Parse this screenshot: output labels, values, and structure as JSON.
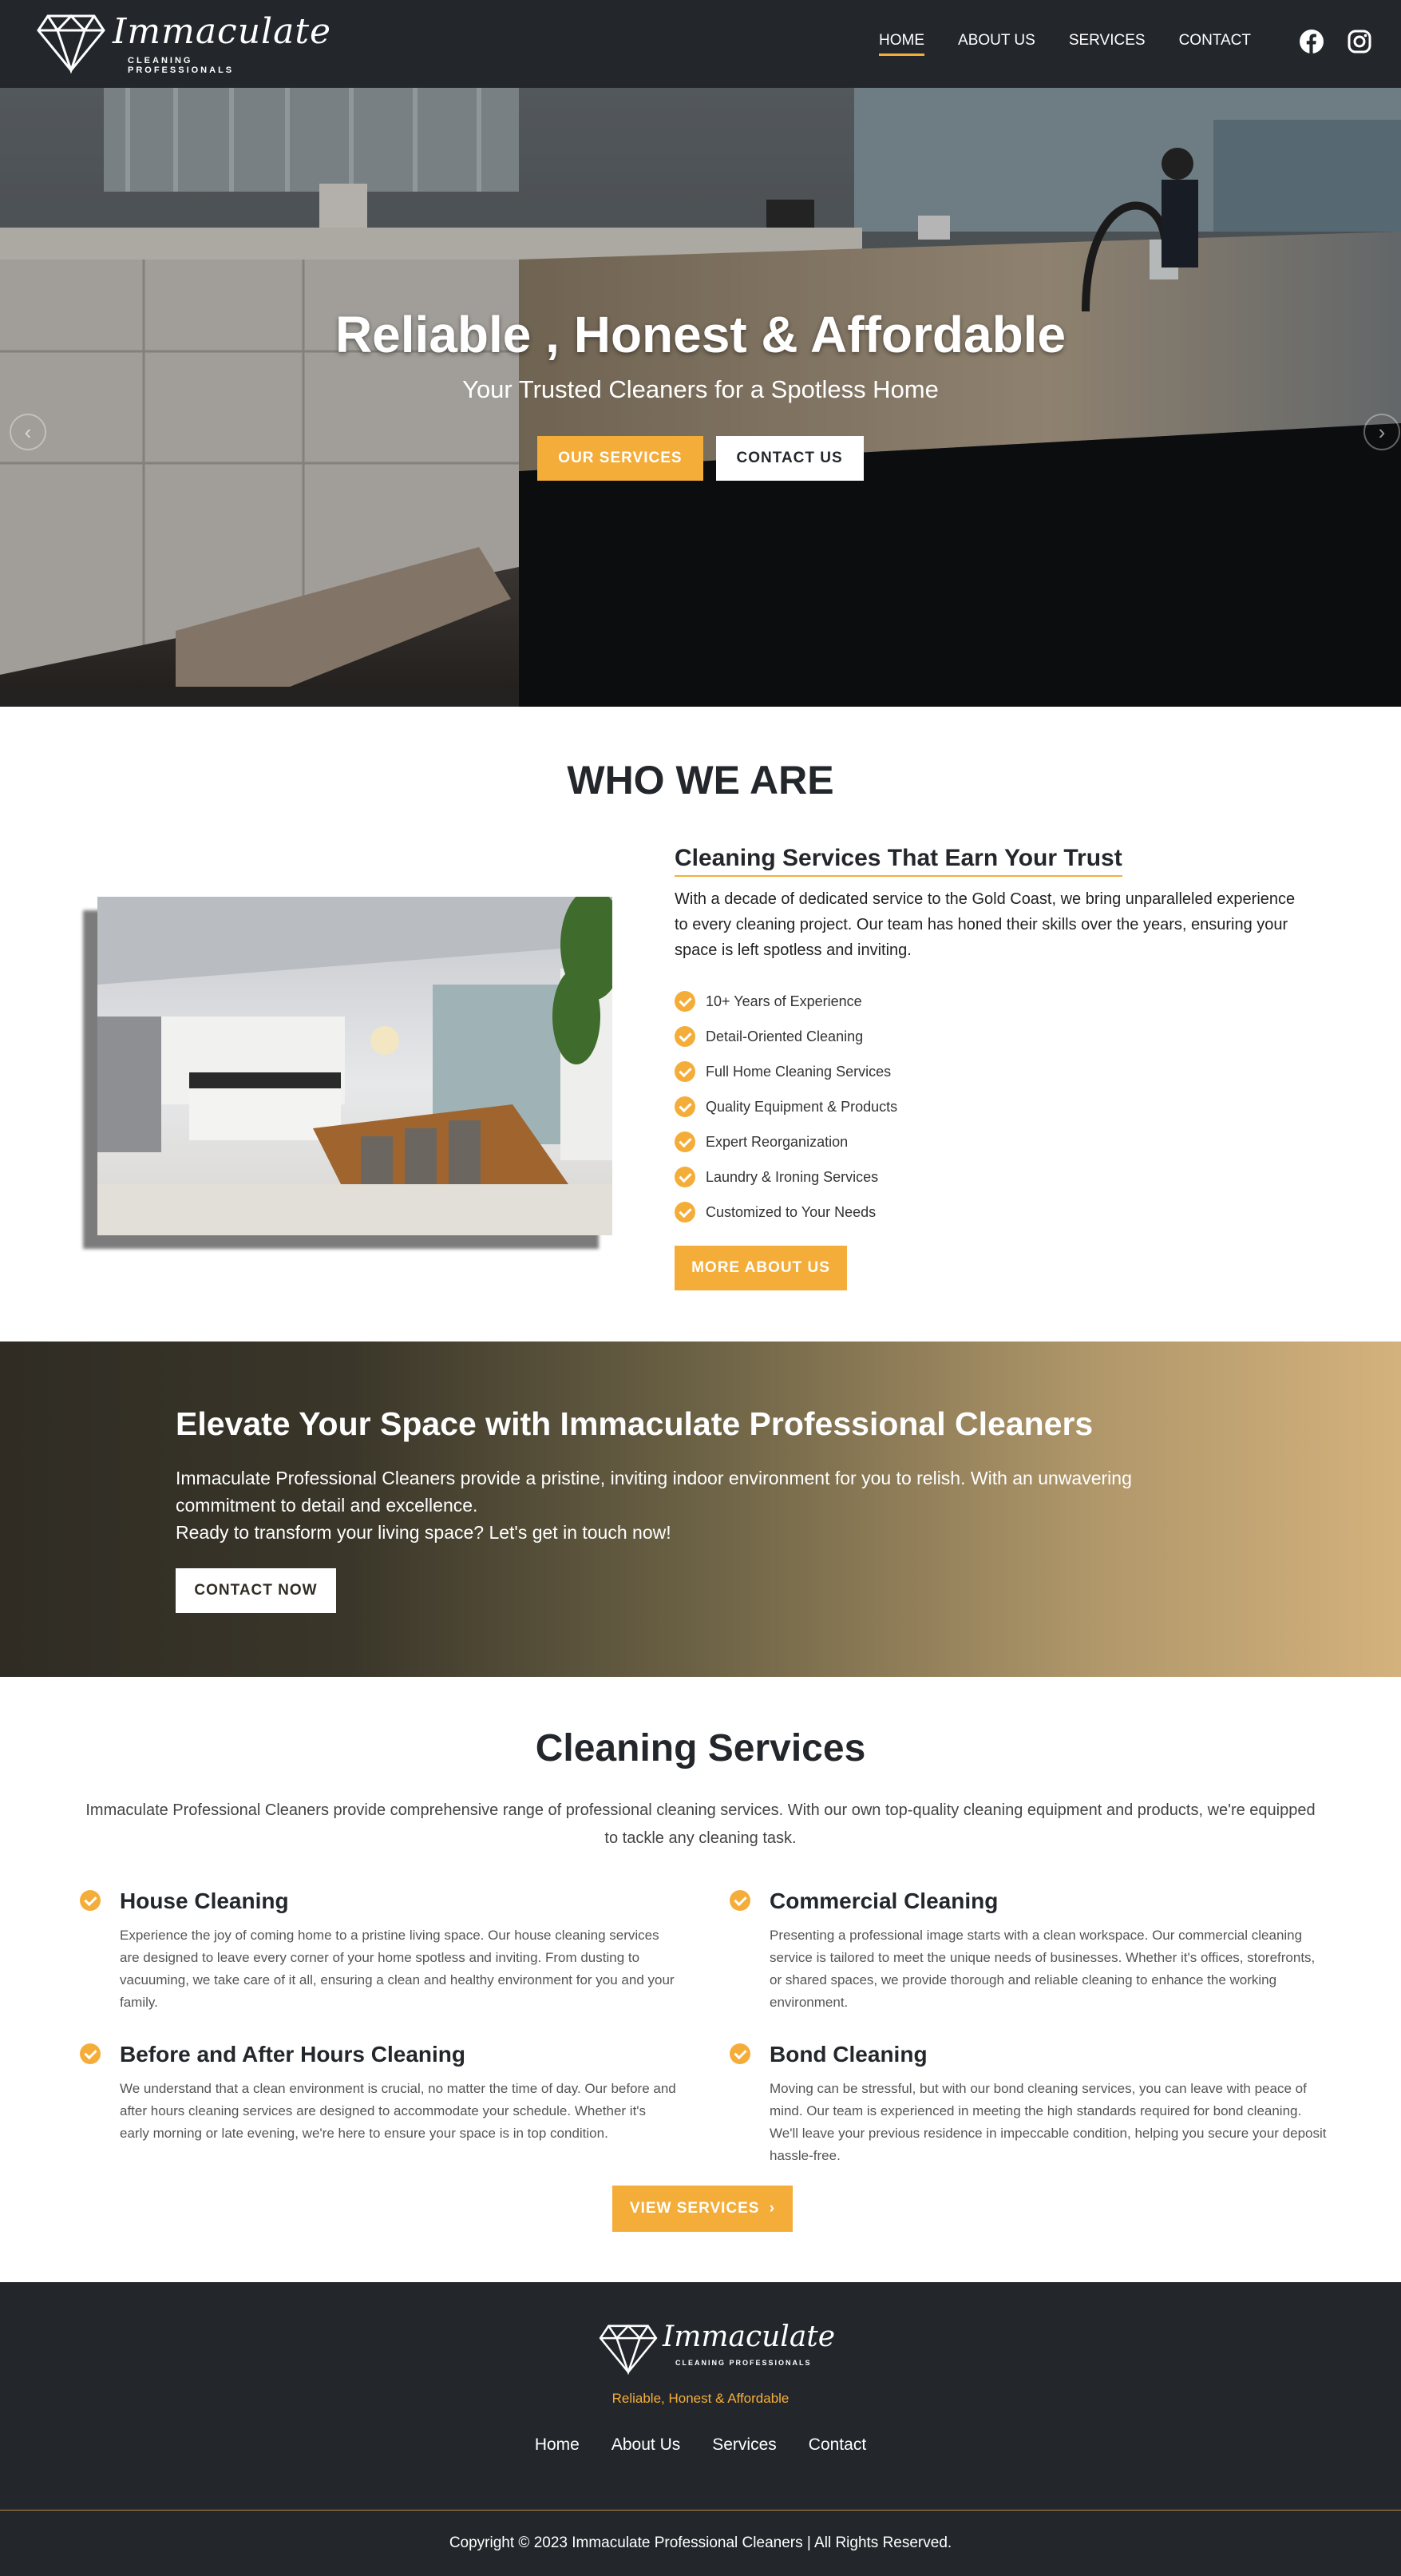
{
  "header": {
    "brand_name": "Immaculate",
    "brand_tagline": "CLEANING PROFESSIONALS",
    "nav": [
      {
        "label": "HOME",
        "active": true
      },
      {
        "label": "ABOUT US",
        "active": false
      },
      {
        "label": "SERVICES",
        "active": false
      },
      {
        "label": "CONTACT",
        "active": false
      }
    ],
    "social_icons": [
      "facebook-icon",
      "instagram-icon"
    ]
  },
  "hero": {
    "title": "Reliable , Honest & Affordable",
    "subtitle": "Your Trusted Cleaners for a Spotless Home",
    "primary_button": "OUR SERVICES",
    "secondary_button": "CONTACT US",
    "prev_icon": "chevron-left-icon",
    "next_icon": "chevron-right-icon"
  },
  "who": {
    "title": "WHO WE ARE",
    "heading": "Cleaning Services That Earn Your Trust",
    "paragraph": "With a decade of dedicated service to the Gold Coast, we bring unparalleled experience to every cleaning project. Our team has honed their skills over the years, ensuring your space is left spotless and inviting.",
    "features": [
      "10+ Years of Experience",
      "Detail-Oriented Cleaning",
      "Full Home Cleaning Services",
      "Quality Equipment & Products",
      "Expert Reorganization",
      "Laundry & Ironing Services",
      "Customized to Your Needs"
    ],
    "button": "MORE ABOUT US"
  },
  "cta": {
    "title": "Elevate Your Space with Immaculate Professional Cleaners",
    "line1": "Immaculate Professional Cleaners provide a pristine, inviting indoor environment for you to relish. With an unwavering commitment to detail and excellence.",
    "line2": "Ready to transform your living space? Let's get in touch now!",
    "button": "CONTACT NOW"
  },
  "services": {
    "title": "Cleaning Services",
    "intro": "Immaculate Professional Cleaners provide comprehensive range of professional cleaning services. With our own top-quality cleaning equipment and products, we're equipped to tackle any cleaning task.",
    "items": [
      {
        "title": "House Cleaning",
        "text": "Experience the joy of coming home to a pristine living space. Our house cleaning services are designed to leave every corner of your home spotless and inviting. From dusting to vacuuming, we take care of it all, ensuring a clean and healthy environment for you and your family."
      },
      {
        "title": "Commercial Cleaning",
        "text": "Presenting a professional image starts with a clean workspace. Our commercial cleaning service is tailored to meet the unique needs of businesses. Whether it's offices, storefronts, or shared spaces, we provide thorough and reliable cleaning to enhance the working environment."
      },
      {
        "title": "Before and After Hours Cleaning",
        "text": "We understand that a clean environment is crucial, no matter the time of day. Our before and after hours cleaning services are designed to accommodate your schedule. Whether it's early morning or late evening, we're here to ensure your space is in top condition."
      },
      {
        "title": "Bond Cleaning",
        "text": "Moving can be stressful, but with our bond cleaning services, you can leave with peace of mind. Our team is experienced in meeting the high standards required for bond cleaning. We'll leave your previous residence in impeccable condition, helping you secure your deposit hassle-free."
      }
    ],
    "button": "VIEW SERVICES"
  },
  "footer": {
    "brand_name": "Immaculate",
    "brand_tagline": "CLEANING PROFESSIONALS",
    "tagline": "Reliable, Honest & Affordable",
    "links": [
      "Home",
      "About Us",
      "Services",
      "Contact"
    ],
    "copyright": "Copyright © 2023 Immaculate Professional Cleaners | All Rights Reserved."
  },
  "colors": {
    "accent": "#f5ad3a",
    "dark": "#23272c"
  }
}
